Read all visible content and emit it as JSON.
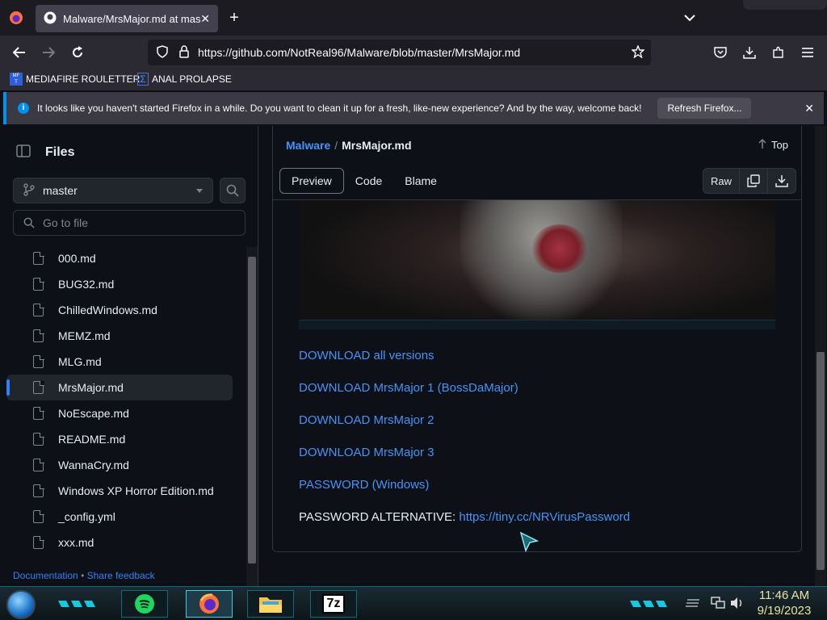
{
  "browser": {
    "tab_title": "Malware/MrsMajor.md at mast",
    "url": "https://github.com/NotReal96/Malware/blob/master/MrsMajor.md",
    "bookmarks": [
      "MEDIAFIRE ROULETTER",
      "ANAL PROLAPSE"
    ],
    "notice_text": "It looks like you haven't started Firefox in a while. Do you want to clean it up for a fresh, like-new experience? And by the way, welcome back!",
    "notice_button": "Refresh Firefox..."
  },
  "sidebar": {
    "title": "Files",
    "branch": "master",
    "goto_placeholder": "Go to file",
    "files": [
      "000.md",
      "BUG32.md",
      "ChilledWindows.md",
      "MEMZ.md",
      "MLG.md",
      "MrsMajor.md",
      "NoEscape.md",
      "README.md",
      "WannaCry.md",
      "Windows XP Horror Edition.md",
      "_config.yml",
      "xxx.md"
    ],
    "active_file": "MrsMajor.md",
    "footer_docs": "Documentation",
    "footer_sep": "•",
    "footer_feedback": "Share feedback"
  },
  "header": {
    "repo": "Malware",
    "sep": "/",
    "file": "MrsMajor.md",
    "top_label": "Top",
    "tabs": [
      "Preview",
      "Code",
      "Blame"
    ],
    "active_tab": "Preview",
    "raw_label": "Raw"
  },
  "content": {
    "links": [
      "DOWNLOAD all versions",
      "DOWNLOAD MrsMajor 1 (BossDaMajor)",
      "DOWNLOAD MrsMajor 2",
      "DOWNLOAD MrsMajor 3",
      "PASSWORD (Windows)"
    ],
    "pw_alt_label": "PASSWORD ALTERNATIVE:",
    "pw_alt_link": "https://tiny.cc/NRVirusPassword"
  },
  "taskbar": {
    "time": "11:46 AM",
    "date": "9/19/2023",
    "sevenzip_label": "7z"
  },
  "colors": {
    "link": "#4493f8",
    "accent": "#2f81f7",
    "background": "#0d1117"
  }
}
